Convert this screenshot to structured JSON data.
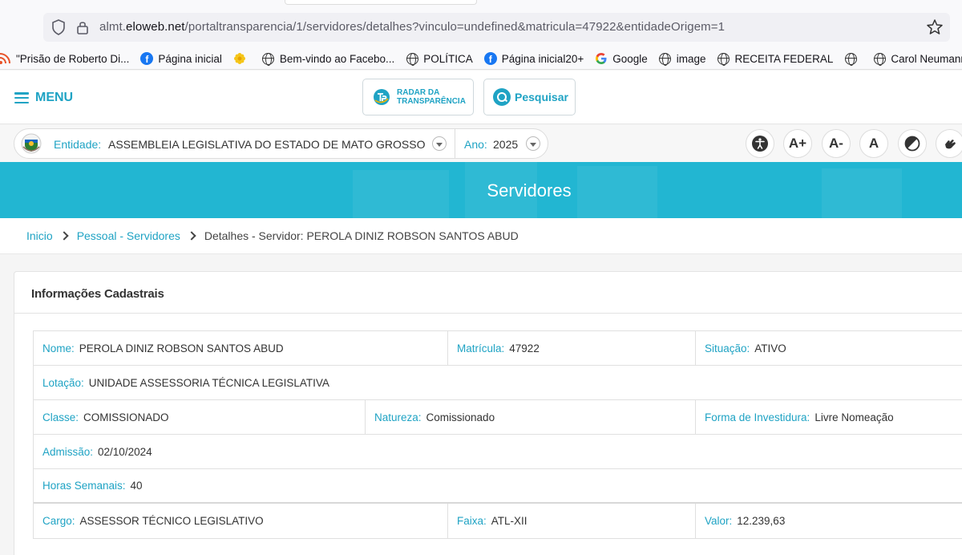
{
  "browser": {
    "url_prefix": "almt.",
    "url_domain": "eloweb.net",
    "url_path": "/portaltransparencia/1/servidores/detalhes?vinculo=undefined&matricula=47922&entidadeOrigem=1",
    "bookmarks": [
      {
        "label": "\"Prisão de Roberto Di...",
        "icon": "rss-icon"
      },
      {
        "label": "Página inicial",
        "icon": "facebook-icon"
      },
      {
        "label": "",
        "icon": "flower-icon"
      },
      {
        "label": "Bem-vindo ao Facebo...",
        "icon": "globe-icon"
      },
      {
        "label": "POLÍTICA",
        "icon": "globe-icon"
      },
      {
        "label": "Página inicial20+",
        "icon": "facebook-icon"
      },
      {
        "label": "Google",
        "icon": "google-icon"
      },
      {
        "label": "image",
        "icon": "globe-icon"
      },
      {
        "label": "RECEITA FEDERAL",
        "icon": "globe-icon"
      },
      {
        "label": "",
        "icon": "globe-icon"
      },
      {
        "label": "Carol Neumann",
        "icon": "globe-icon"
      }
    ]
  },
  "header": {
    "menu_label": "MENU",
    "radar_line1": "RADAR DA",
    "radar_line2": "TRANSPARÊNCIA",
    "search_label": "Pesquisar"
  },
  "entity_bar": {
    "entity_label": "Entidade:",
    "entity_value": "ASSEMBLEIA LEGISLATIVA DO ESTADO DE MATO GROSSO",
    "year_label": "Ano:",
    "year_value": "2025",
    "font_plus": "A+",
    "font_minus": "A-",
    "font_reset": "A"
  },
  "banner": {
    "title": "Servidores"
  },
  "breadcrumb": {
    "home": "Inicio",
    "section": "Pessoal - Servidores",
    "current": "Detalhes - Servidor: PEROLA DINIZ ROBSON SANTOS ABUD"
  },
  "card": {
    "title": "Informações Cadastrais",
    "fields": {
      "nome": {
        "label": "Nome:",
        "value": "PEROLA DINIZ ROBSON SANTOS ABUD"
      },
      "matricula": {
        "label": "Matrícula:",
        "value": "47922"
      },
      "situacao": {
        "label": "Situação:",
        "value": "ATIVO"
      },
      "lotacao": {
        "label": "Lotação:",
        "value": "UNIDADE ASSESSORIA TÉCNICA LEGISLATIVA"
      },
      "classe": {
        "label": "Classe:",
        "value": "COMISSIONADO"
      },
      "natureza": {
        "label": "Natureza:",
        "value": "Comissionado"
      },
      "investidura": {
        "label": "Forma de Investidura:",
        "value": "Livre Nomeação"
      },
      "admissao": {
        "label": "Admissão:",
        "value": "02/10/2024"
      },
      "horas": {
        "label": "Horas Semanais:",
        "value": "40"
      },
      "cargo": {
        "label": "Cargo:",
        "value": "ASSESSOR TÉCNICO LEGISLATIVO"
      },
      "faixa": {
        "label": "Faixa:",
        "value": "ATL-XII"
      },
      "valor": {
        "label": "Valor:",
        "value": "12.239,63"
      }
    }
  },
  "colors": {
    "accent": "#1fa3c4",
    "banner": "#22b6d2"
  }
}
